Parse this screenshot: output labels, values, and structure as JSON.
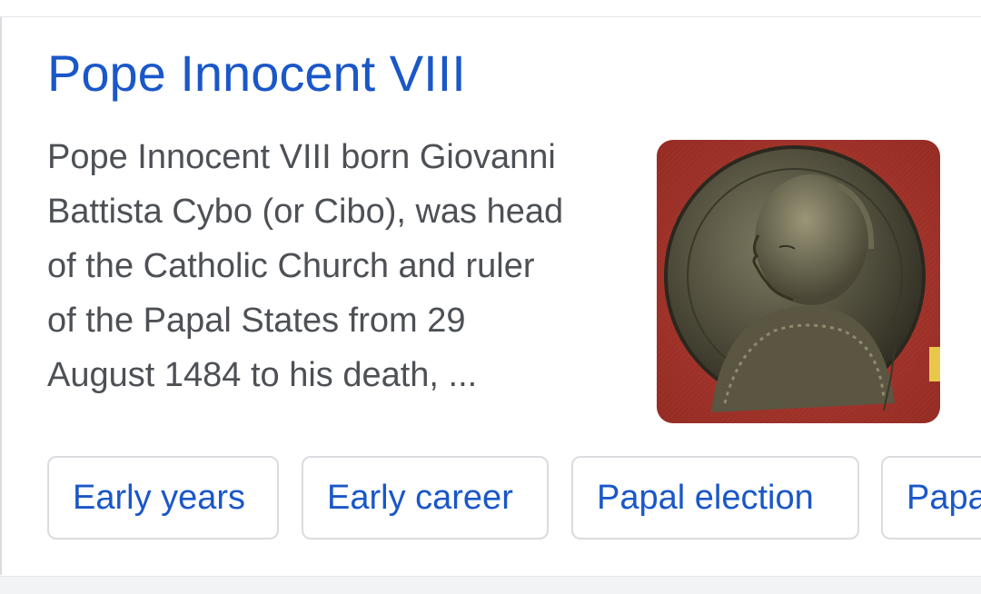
{
  "result": {
    "title": "Pope Innocent VIII",
    "snippet_lines": [
      "Pope Innocent VIII born Giovanni",
      "Battista Cybo (or Cibo), was head",
      "of the Catholic Church and ruler",
      "of the Papal States from 29",
      "August 1484 to his death, ..."
    ],
    "image_icon": "medal-portrait-image",
    "chips": [
      {
        "label": "Early years"
      },
      {
        "label": "Early career"
      },
      {
        "label": "Papal election"
      },
      {
        "label": "Papa"
      }
    ]
  },
  "colors": {
    "title_link": "#1a57c8",
    "snippet_text": "#4d5156",
    "chip_border": "#dadce0",
    "medal_background": "#a8352c"
  }
}
